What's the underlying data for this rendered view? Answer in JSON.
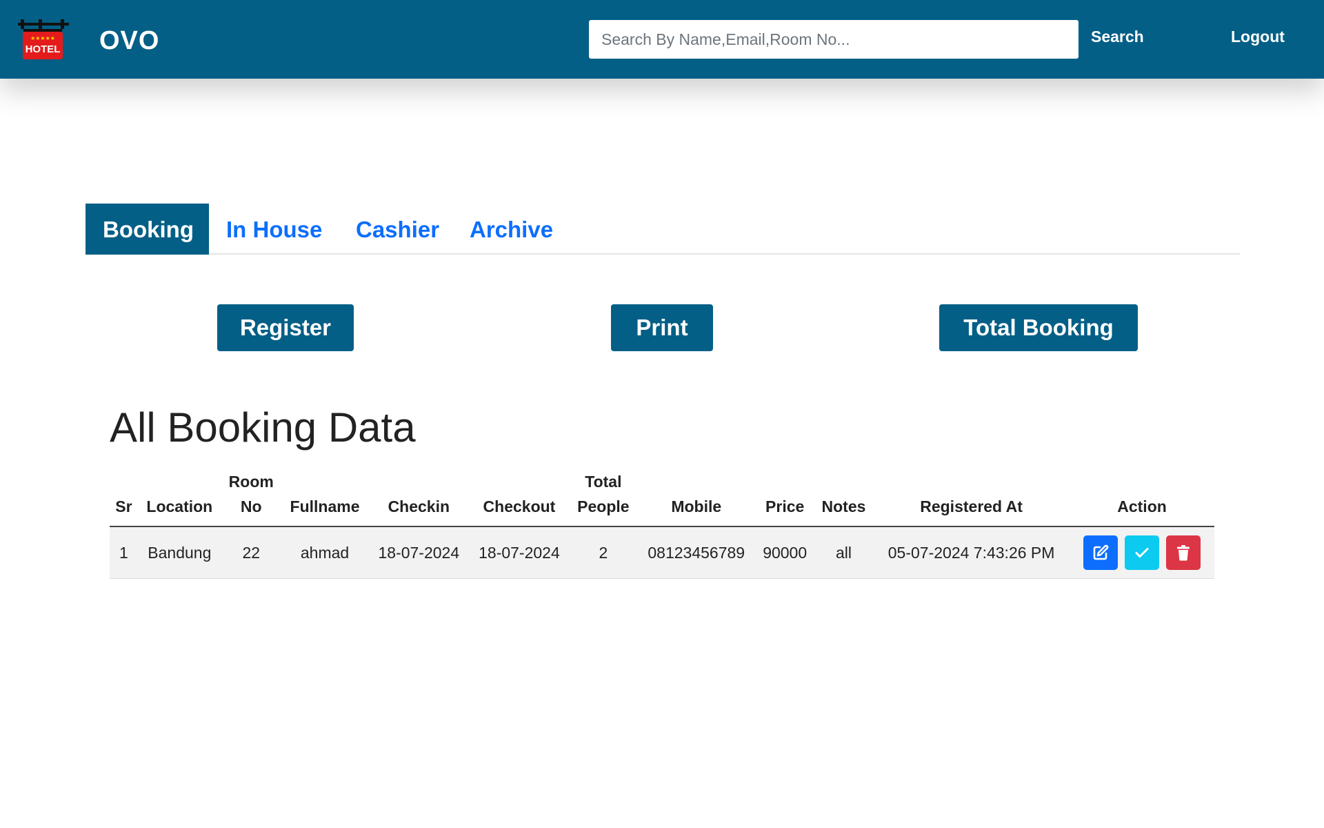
{
  "header": {
    "logo_text": "HOTEL",
    "brand": "OVO",
    "search_placeholder": "Search By Name,Email,Room No...",
    "search_button": "Search",
    "logout_button": "Logout"
  },
  "tabs": [
    {
      "label": "Booking",
      "active": true
    },
    {
      "label": "In House",
      "active": false
    },
    {
      "label": "Cashier",
      "active": false
    },
    {
      "label": "Archive",
      "active": false
    }
  ],
  "actions": {
    "register": "Register",
    "print": "Print",
    "total_booking": "Total Booking"
  },
  "page_title": "All Booking Data",
  "table": {
    "headers": {
      "sr": "Sr",
      "location": "Location",
      "room_no_1": "Room",
      "room_no_2": "No",
      "fullname": "Fullname",
      "checkin": "Checkin",
      "checkout": "Checkout",
      "total_people_1": "Total",
      "total_people_2": "People",
      "mobile": "Mobile",
      "price": "Price",
      "notes": "Notes",
      "registered_at": "Registered At",
      "action": "Action"
    },
    "rows": [
      {
        "sr": "1",
        "location": "Bandung",
        "room_no": "22",
        "fullname": "ahmad",
        "checkin": "18-07-2024",
        "checkout": "18-07-2024",
        "total_people": "2",
        "mobile": "08123456789",
        "price": "90000",
        "notes": "all",
        "registered_at": "05-07-2024 7:43:26 PM"
      }
    ]
  },
  "colors": {
    "primary": "#045f86",
    "edit": "#0d6efd",
    "check": "#0dcaf0",
    "delete": "#dc3545"
  },
  "icons": [
    "hotel-sign-icon",
    "edit-icon",
    "check-icon",
    "trash-icon"
  ]
}
